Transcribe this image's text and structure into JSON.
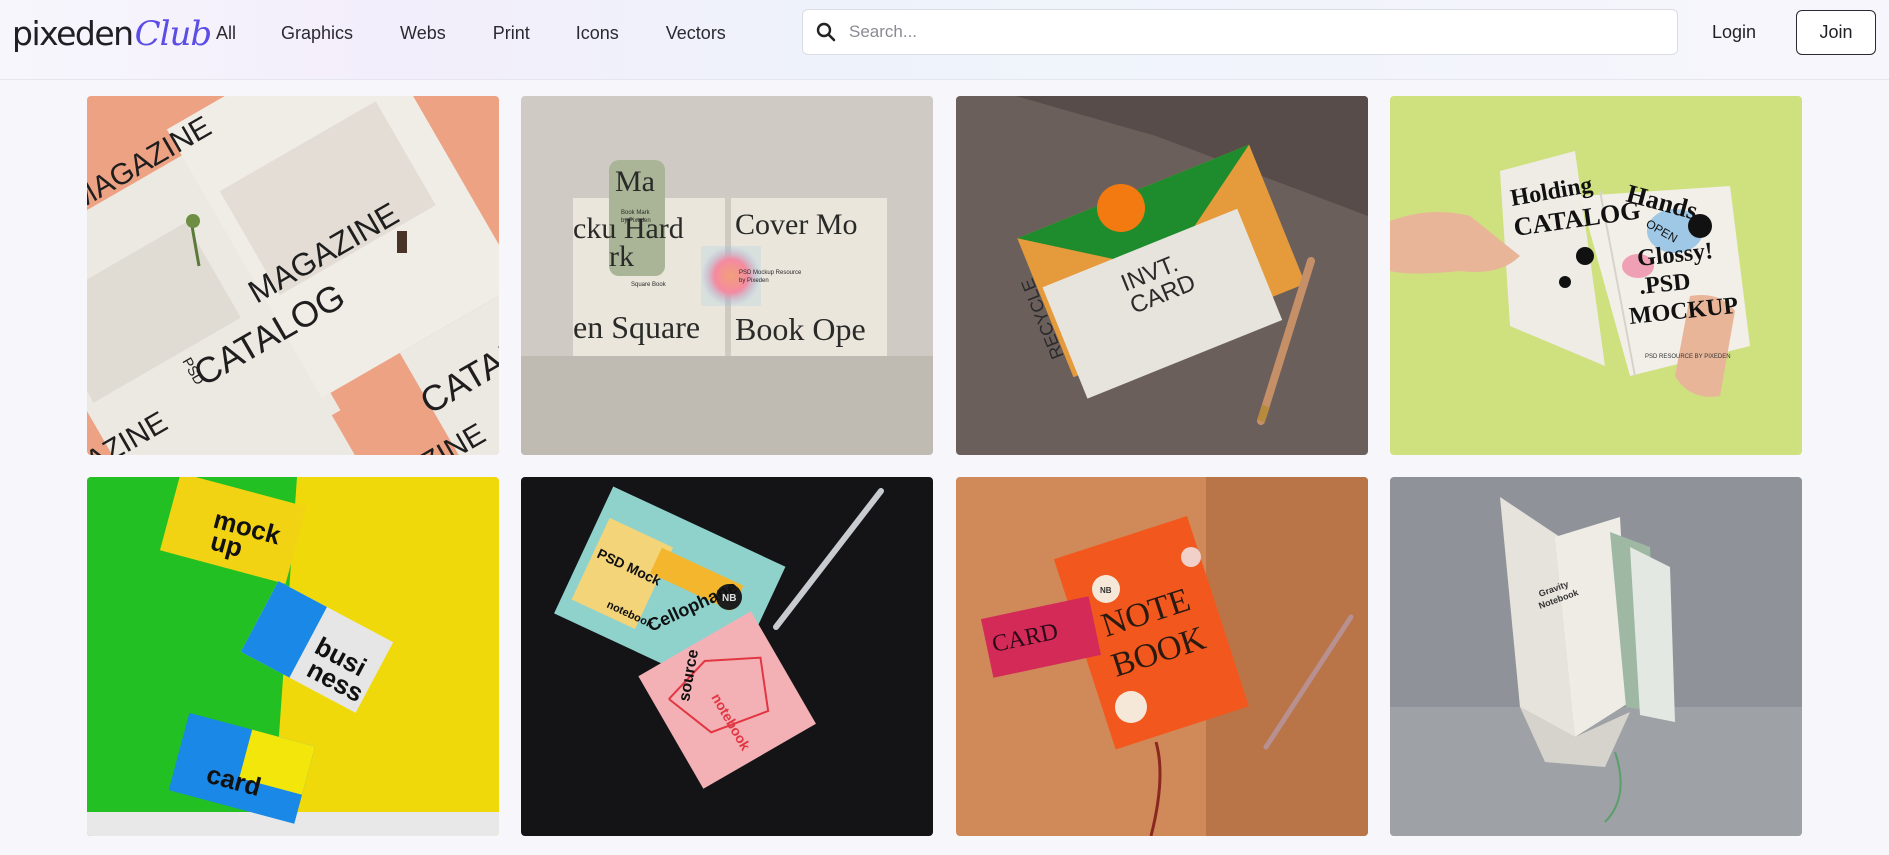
{
  "brand": {
    "name": "pixeden",
    "suffix": "Club"
  },
  "nav": {
    "items": [
      {
        "label": "All"
      },
      {
        "label": "Graphics"
      },
      {
        "label": "Webs"
      },
      {
        "label": "Print"
      },
      {
        "label": "Icons"
      },
      {
        "label": "Vectors"
      }
    ]
  },
  "search": {
    "placeholder": "Search...",
    "value": ""
  },
  "auth": {
    "login_label": "Login",
    "join_label": "Join"
  },
  "cards": [
    {
      "texts": [
        "MAGAZINE",
        "CATALOG",
        "MAGAZINE",
        "CATALO",
        "AZINE",
        "PSD",
        "ZINE"
      ]
    },
    {
      "texts": [
        "Ma",
        "rk",
        "Book Mark",
        "by Pixeden",
        "cku Hard",
        "Cover Mo",
        "en Square",
        "Book Ope",
        "PSD Mockup Resource",
        "by Pixeden",
        "Square Book"
      ]
    },
    {
      "texts": [
        "INVT.",
        "CARD",
        "RECYCLE"
      ]
    },
    {
      "texts": [
        "Hands",
        "Holding",
        "OPEN",
        "CATALOG",
        "Glossy!",
        ".PSD",
        "MOCKUP",
        "PSD RESOURCE BY PIXEDEN"
      ]
    },
    {
      "texts": [
        "mock",
        "up",
        "busi",
        "ness",
        "card"
      ]
    },
    {
      "texts": [
        "PSD Mock",
        "notebook",
        "Cellophane",
        "NB",
        "source",
        "notebook"
      ]
    },
    {
      "texts": [
        "NOTE",
        "BOOK",
        "CARD",
        "NB"
      ]
    },
    {
      "texts": [
        "Gravity",
        "Notebook"
      ]
    }
  ]
}
